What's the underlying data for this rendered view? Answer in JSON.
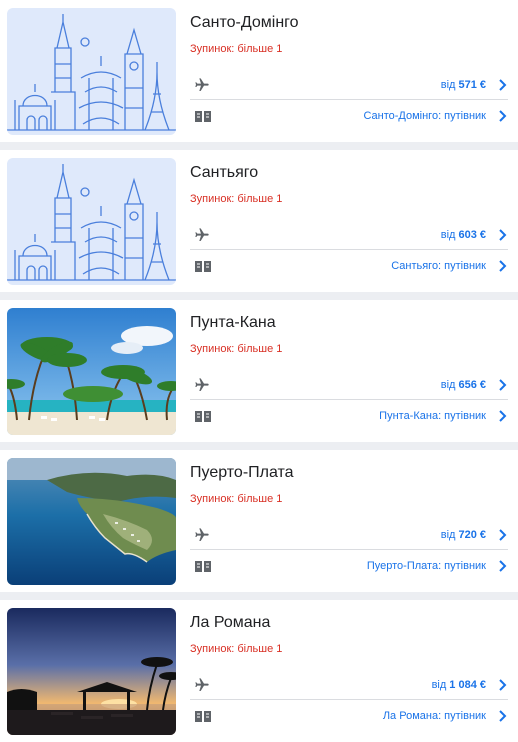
{
  "colors": {
    "link": "#1a73e8",
    "stops": "#d93025",
    "separator": "#eceef2",
    "illustration_bg": "#dfe9fb",
    "illustration_stroke": "#4a7fdc"
  },
  "destinations": [
    {
      "title": "Санто-Домінго",
      "stops": "Зупинок: більше 1",
      "price_prefix": "від",
      "price": "571 €",
      "guide": "Санто-Домінго: путівник",
      "image": "city-landmarks-illustration"
    },
    {
      "title": "Сантьяго",
      "stops": "Зупинок: більше 1",
      "price_prefix": "від",
      "price": "603 €",
      "guide": "Сантьяго: путівник",
      "image": "city-landmarks-illustration"
    },
    {
      "title": "Пунта-Кана",
      "stops": "Зупинок: більше 1",
      "price_prefix": "від",
      "price": "656 €",
      "guide": "Пунта-Кана: путівник",
      "image": "palm-beach-photo"
    },
    {
      "title": "Пуерто-Плата",
      "stops": "Зупинок: більше 1",
      "price_prefix": "від",
      "price": "720 €",
      "guide": "Пуерто-Плата: путівник",
      "image": "coastline-aerial-photo"
    },
    {
      "title": "Ла Романа",
      "stops": "Зупинок: більше 1",
      "price_prefix": "від",
      "price": "1 084 €",
      "guide": "Ла Романа: путівник",
      "image": "sunset-beach-photo"
    }
  ],
  "icons": {
    "flight": "airplane-icon",
    "guide": "book-icon",
    "link": "chevron-right-icon"
  }
}
